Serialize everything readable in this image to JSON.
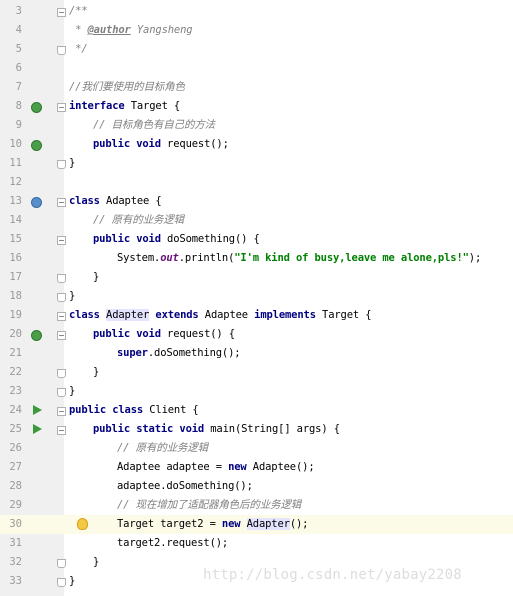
{
  "editor": {
    "current_line": 30,
    "lines": [
      {
        "n": "3"
      },
      {
        "n": "4"
      },
      {
        "n": "5"
      },
      {
        "n": "6"
      },
      {
        "n": "7"
      },
      {
        "n": "8"
      },
      {
        "n": "9"
      },
      {
        "n": "10"
      },
      {
        "n": "11"
      },
      {
        "n": "12"
      },
      {
        "n": "13"
      },
      {
        "n": "14"
      },
      {
        "n": "15"
      },
      {
        "n": "16"
      },
      {
        "n": "17"
      },
      {
        "n": "18"
      },
      {
        "n": "19"
      },
      {
        "n": "20"
      },
      {
        "n": "21"
      },
      {
        "n": "22"
      },
      {
        "n": "23"
      },
      {
        "n": "24"
      },
      {
        "n": "25"
      },
      {
        "n": "26"
      },
      {
        "n": "27"
      },
      {
        "n": "28"
      },
      {
        "n": "29"
      },
      {
        "n": "30"
      },
      {
        "n": "31"
      },
      {
        "n": "32"
      },
      {
        "n": "33"
      }
    ],
    "code": {
      "l3_a": "/**",
      "l4_star": " * ",
      "l4_tag": "@author",
      "l4_name": " Yangsheng",
      "l5": " */",
      "l7": "//我们要使用的目标角色",
      "l8_kw": "interface",
      "l8_rest": " Target {",
      "l9": "// 目标角色有自己的方法",
      "l10_kw1": "public",
      "l10_kw2": "void",
      "l10_rest": " request();",
      "brace_close": "}",
      "l13_kw": "class",
      "l13_rest": " Adaptee {",
      "l14": "// 原有的业务逻辑",
      "l15_kw1": "public",
      "l15_kw2": "void",
      "l15_rest": " doSomething() {",
      "l16_a": "System.",
      "l16_field": "out",
      "l16_b": ".println(",
      "l16_str": "\"I'm kind of busy,leave me alone,pls!\"",
      "l16_c": ");",
      "l19_kw1": "class",
      "l19_hl": "Adapter",
      "l19_kw2": "extends",
      "l19_mid": " Adaptee ",
      "l19_kw3": "implements",
      "l19_rest": " Target {",
      "l20_kw1": "public",
      "l20_kw2": "void",
      "l20_rest": " request() {",
      "l21_kw": "super",
      "l21_rest": ".doSomething();",
      "l24_kw1": "public",
      "l24_kw2": "class",
      "l24_rest": " Client {",
      "l25_kw1": "public",
      "l25_kw2": "static",
      "l25_kw3": "void",
      "l25_rest": " main(String[] args) {",
      "l26": "// 原有的业务逻辑",
      "l27_a": "Adaptee adaptee = ",
      "l27_kw": "new",
      "l27_b": " Adaptee();",
      "l28": "adaptee.doSomething();",
      "l29": "// 现在增加了适配器角色后的业务逻辑",
      "l30_a": "Target target2 = ",
      "l30_kw": "new",
      "l30_hl": "Adapter",
      "l30_b": "();",
      "l31": "target2.request();"
    }
  },
  "watermark": "http://blog.csdn.net/yabay2208",
  "colors": {
    "keyword": "#000080",
    "comment": "#808080",
    "string": "#008000",
    "field": "#660e7a",
    "gutter": "#f0f0f0",
    "current_line": "#fcfbe8",
    "highlight": "#e4e4ff"
  }
}
